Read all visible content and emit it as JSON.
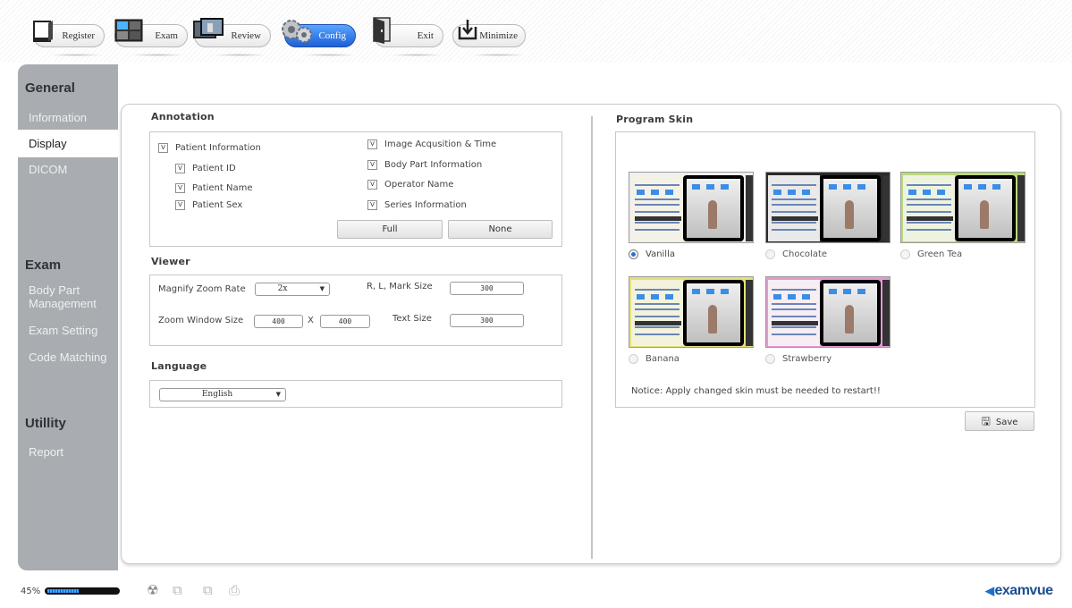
{
  "toolbar": {
    "buttons": [
      {
        "label": "Register",
        "icon": "register-icon",
        "active": false
      },
      {
        "label": "Exam",
        "icon": "exam-icon",
        "active": false
      },
      {
        "label": "Review",
        "icon": "review-icon",
        "active": false
      },
      {
        "label": "Config",
        "icon": "config-gear-icon",
        "active": true
      },
      {
        "label": "Exit",
        "icon": "exit-door-icon",
        "active": false
      },
      {
        "label": "Minimize",
        "icon": "minimize-icon",
        "active": false
      }
    ]
  },
  "sidebar": {
    "general": {
      "title": "General",
      "items": [
        "Information",
        "Display",
        "DICOM"
      ],
      "active": "Display"
    },
    "exam": {
      "title": "Exam",
      "items": [
        "Body Part Management",
        "Exam Setting",
        "Code Matching"
      ]
    },
    "utility": {
      "title": "Utillity",
      "items": [
        "Report"
      ]
    }
  },
  "annotation": {
    "title": "Annotation",
    "check_mark": "V",
    "left": [
      {
        "label": "Patient Information",
        "checked": true
      },
      {
        "label": "Patient ID",
        "checked": true
      },
      {
        "label": "Patient Name",
        "checked": true
      },
      {
        "label": "Patient Sex",
        "checked": true
      }
    ],
    "right": [
      {
        "label": "Image Acqusition & Time",
        "checked": true
      },
      {
        "label": "Body Part Information",
        "checked": true
      },
      {
        "label": "Operator Name",
        "checked": true
      },
      {
        "label": "Series Information",
        "checked": true
      }
    ],
    "full_label": "Full",
    "none_label": "None"
  },
  "viewer": {
    "title": "Viewer",
    "magnify_label": "Magnify Zoom Rate",
    "magnify_value": "2x",
    "mark_size_label": "R, L, Mark Size",
    "mark_size_value": "300",
    "zoom_window_label": "Zoom Window Size",
    "zoom_w": "400",
    "zoom_x": "X",
    "zoom_h": "400",
    "text_size_label": "Text Size",
    "text_size_value": "300"
  },
  "language": {
    "title": "Language",
    "value": "English"
  },
  "program_skin": {
    "title": "Program Skin",
    "skins": [
      {
        "name": "Vanilla",
        "selected": true,
        "panel_color": "#f4f1e6",
        "frame_color": "#eeeeee"
      },
      {
        "name": "Chocolate",
        "selected": false,
        "panel_color": "#e9e9e9",
        "frame_color": "#2a2a2a"
      },
      {
        "name": "Green Tea",
        "selected": false,
        "panel_color": "#eef3e0",
        "frame_color": "#b9d97a"
      },
      {
        "name": "Banana",
        "selected": false,
        "panel_color": "#f3f3dc",
        "frame_color": "#e1e07a"
      },
      {
        "name": "Strawberry",
        "selected": false,
        "panel_color": "#f6eef4",
        "frame_color": "#e29ad0"
      }
    ],
    "notice": "Notice: Apply changed skin must be needed to restart!!",
    "save_label": "Save"
  },
  "status": {
    "zoom_text": "45%",
    "zoom_fraction": 0.45,
    "icons": [
      "radiation-icon",
      "layout-icon",
      "layout-alt-icon",
      "print-icon"
    ],
    "logo": "examvue"
  },
  "colors": {
    "accent": "#1d5fd6",
    "sidebar": "#a9acb0",
    "radio_selected": "#2f6fd0"
  }
}
